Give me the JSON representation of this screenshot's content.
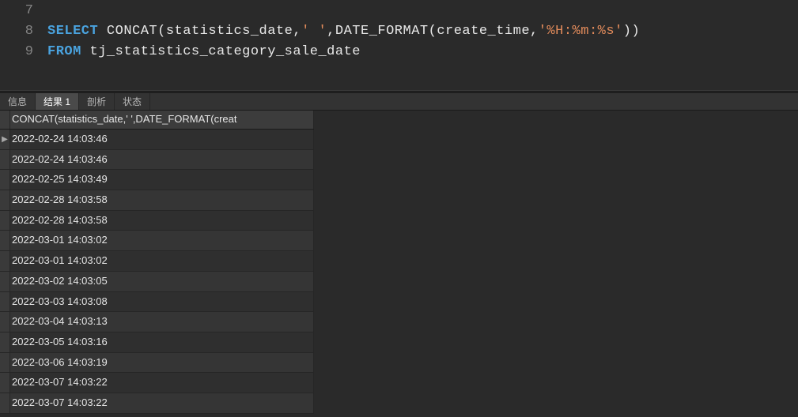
{
  "editor": {
    "lines": [
      {
        "num": 7,
        "tokens": []
      },
      {
        "num": 8,
        "tokens": [
          {
            "t": "kw",
            "v": "SELECT"
          },
          {
            "t": "punct",
            "v": " "
          },
          {
            "t": "func",
            "v": "CONCAT"
          },
          {
            "t": "punct",
            "v": "("
          },
          {
            "t": "ident",
            "v": "statistics_date"
          },
          {
            "t": "punct",
            "v": ","
          },
          {
            "t": "str",
            "v": "' '"
          },
          {
            "t": "punct",
            "v": ","
          },
          {
            "t": "func",
            "v": "DATE_FORMAT"
          },
          {
            "t": "punct",
            "v": "("
          },
          {
            "t": "ident",
            "v": "create_time"
          },
          {
            "t": "punct",
            "v": ","
          },
          {
            "t": "str",
            "v": "'%H:%m:%s'"
          },
          {
            "t": "punct",
            "v": "))"
          }
        ]
      },
      {
        "num": 9,
        "tokens": [
          {
            "t": "kw",
            "v": "FROM"
          },
          {
            "t": "punct",
            "v": " "
          },
          {
            "t": "ident",
            "v": "tj_statistics_category_sale_date"
          }
        ]
      }
    ]
  },
  "tabs": {
    "items": [
      {
        "label": "信息",
        "active": false
      },
      {
        "label": "结果 1",
        "active": true
      },
      {
        "label": "剖析",
        "active": false
      },
      {
        "label": "状态",
        "active": false
      }
    ]
  },
  "results": {
    "column_header": "CONCAT(statistics_date,' ',DATE_FORMAT(creat",
    "rows": [
      "2022-02-24 14:03:46",
      "2022-02-24 14:03:46",
      "2022-02-25 14:03:49",
      "2022-02-28 14:03:58",
      "2022-02-28 14:03:58",
      "2022-03-01 14:03:02",
      "2022-03-01 14:03:02",
      "2022-03-02 14:03:05",
      "2022-03-03 14:03:08",
      "2022-03-04 14:03:13",
      "2022-03-05 14:03:16",
      "2022-03-06 14:03:19",
      "2022-03-07 14:03:22",
      "2022-03-07 14:03:22"
    ],
    "current_row_index": 0
  }
}
